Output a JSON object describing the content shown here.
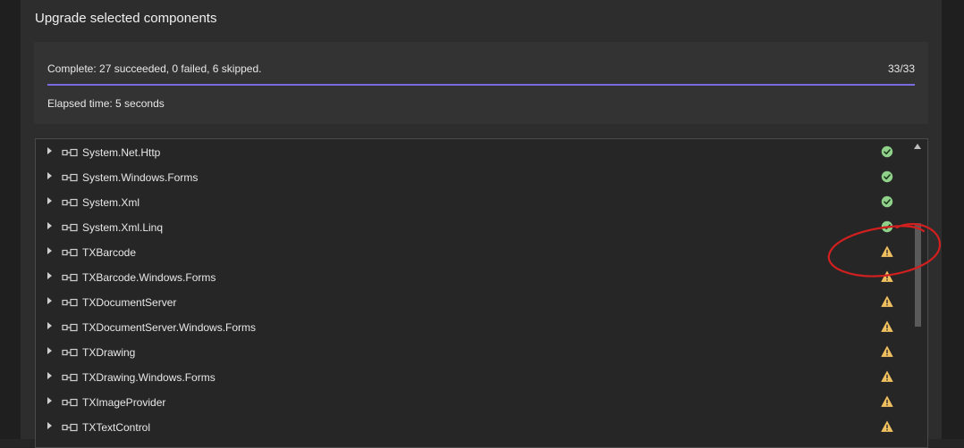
{
  "dialog": {
    "title": "Upgrade selected components"
  },
  "status": {
    "summary": "Complete: 27 succeeded, 0 failed, 6 skipped.",
    "count": "33/33",
    "progress_fraction": 1.0,
    "elapsed": "Elapsed time: 5 seconds"
  },
  "colors": {
    "progress": "#7a6be0",
    "success": "#8fd18a",
    "warning": "#f0c060",
    "annotation": "#d21f1f"
  },
  "list": {
    "items": [
      {
        "label": "System.Net.Http",
        "status": "success"
      },
      {
        "label": "System.Windows.Forms",
        "status": "success"
      },
      {
        "label": "System.Xml",
        "status": "success"
      },
      {
        "label": "System.Xml.Linq",
        "status": "success"
      },
      {
        "label": "TXBarcode",
        "status": "warning"
      },
      {
        "label": "TXBarcode.Windows.Forms",
        "status": "warning"
      },
      {
        "label": "TXDocumentServer",
        "status": "warning"
      },
      {
        "label": "TXDocumentServer.Windows.Forms",
        "status": "warning"
      },
      {
        "label": "TXDrawing",
        "status": "warning"
      },
      {
        "label": "TXDrawing.Windows.Forms",
        "status": "warning"
      },
      {
        "label": "TXImageProvider",
        "status": "warning"
      },
      {
        "label": "TXTextControl",
        "status": "warning"
      }
    ]
  },
  "icons": {
    "expander": "chevron-right-icon",
    "reference": "assembly-reference-icon",
    "success": "check-circle-icon",
    "warning": "warning-triangle-icon",
    "scroll_up": "scroll-up-arrow-icon"
  }
}
